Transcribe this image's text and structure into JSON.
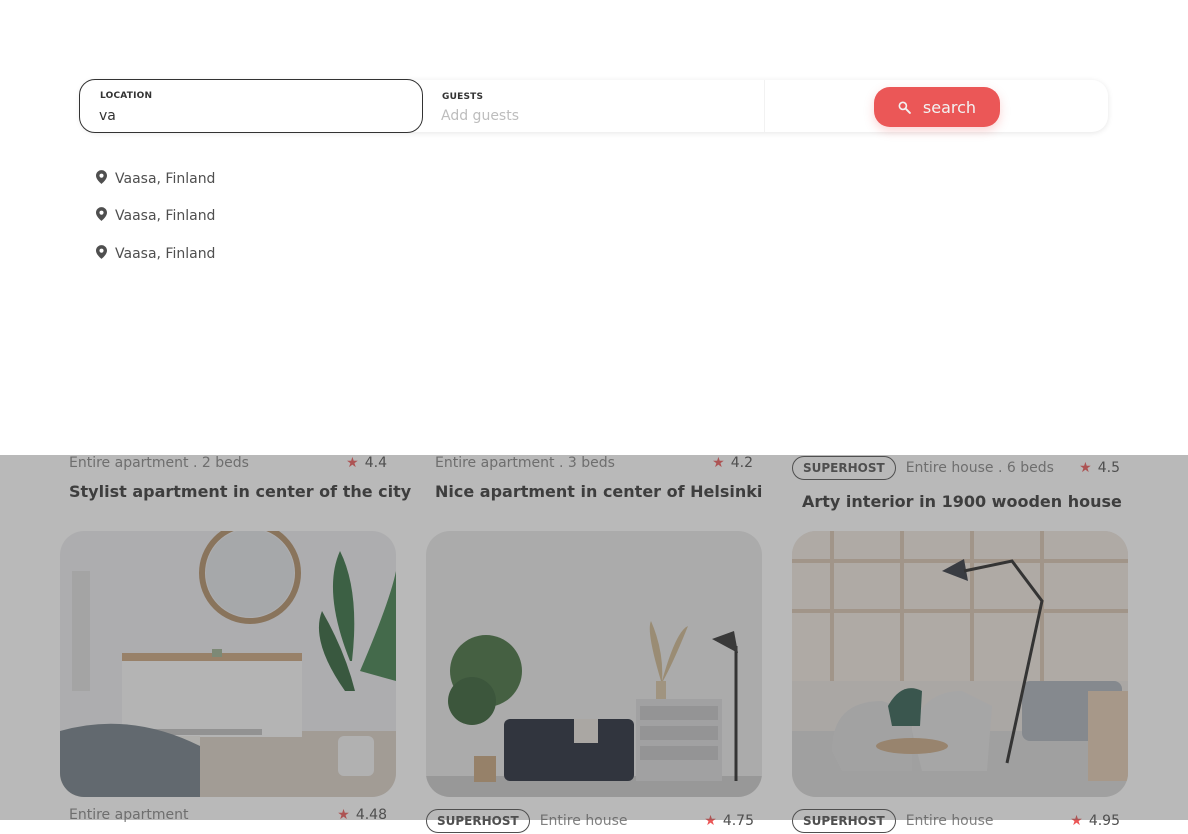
{
  "search": {
    "location_label": "LOCATION",
    "location_value": "va",
    "guests_label": "GUESTS",
    "guests_placeholder": "Add guests",
    "button_label": "search"
  },
  "suggestions": [
    {
      "label": "Vaasa, Finland",
      "icon": "location-pin-icon"
    },
    {
      "label": "Vaasa, Finland",
      "icon": "location-pin-icon"
    },
    {
      "label": "Vaasa, Finland",
      "icon": "location-pin-icon"
    }
  ],
  "listings": [
    {
      "superhost": false,
      "type": "Entire apartment . 2 beds",
      "rating": "4.4",
      "title": "Stylist apartment in center of the city"
    },
    {
      "superhost": false,
      "type": "Entire apartment . 3 beds",
      "rating": "4.2",
      "title": "Nice apartment in center of Helsinki"
    },
    {
      "superhost": true,
      "superhost_label": "SUPERHOST",
      "type": "Entire house . 6 beds",
      "rating": "4.5",
      "title": "Arty interior in 1900 wooden house"
    },
    {
      "superhost": false,
      "type": "Entire apartment",
      "rating": "4.48",
      "title": ""
    },
    {
      "superhost": true,
      "superhost_label": "SUPERHOST",
      "type": "Entire house",
      "rating": "4.75",
      "title": ""
    },
    {
      "superhost": true,
      "superhost_label": "SUPERHOST",
      "type": "Entire house",
      "rating": "4.95",
      "title": ""
    }
  ],
  "photos": [
    {
      "subject": "bedroom-with-mirror-and-plant"
    },
    {
      "subject": "living-room-with-black-sofa"
    },
    {
      "subject": "loft-with-lamp-and-chairs"
    }
  ],
  "colors": {
    "accent": "#eb5757",
    "overlay": "rgba(79,79,79,0.40)",
    "text": "#333333",
    "muted": "#828282"
  }
}
